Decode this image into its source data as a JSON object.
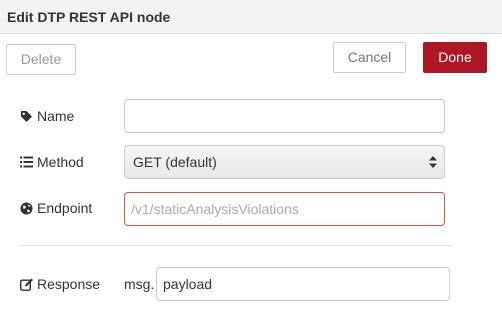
{
  "dialog": {
    "title": "Edit DTP REST API node"
  },
  "toolbar": {
    "delete_label": "Delete",
    "cancel_label": "Cancel",
    "done_label": "Done"
  },
  "form": {
    "name": {
      "label": "Name",
      "value": "",
      "icon": "tag-icon"
    },
    "method": {
      "label": "Method",
      "selected": "GET (default)",
      "icon": "list-icon"
    },
    "endpoint": {
      "label": "Endpoint",
      "value": "",
      "placeholder": "/v1/staticAnalysisViolations",
      "icon": "globe-icon"
    },
    "response": {
      "label": "Response",
      "prefix": "msg.",
      "value": "payload",
      "icon": "edit-icon"
    }
  },
  "colors": {
    "done_button": "#ad1625",
    "error_border": "#d9534f"
  }
}
